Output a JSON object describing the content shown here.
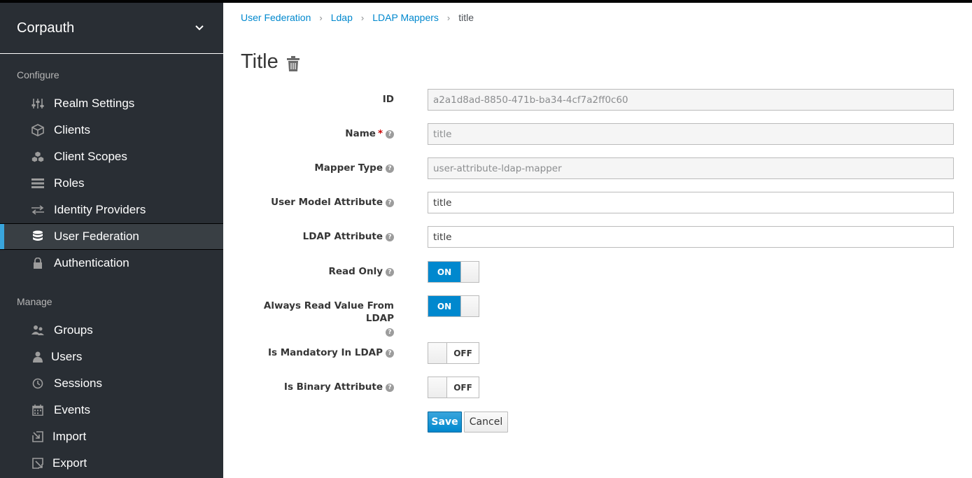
{
  "sidebar": {
    "realm": "Corpauth",
    "configure_label": "Configure",
    "configure_items": [
      {
        "label": "Realm Settings",
        "icon": "sliders-icon"
      },
      {
        "label": "Clients",
        "icon": "cube-icon"
      },
      {
        "label": "Client Scopes",
        "icon": "cubes-icon"
      },
      {
        "label": "Roles",
        "icon": "list-icon"
      },
      {
        "label": "Identity Providers",
        "icon": "exchange-icon"
      },
      {
        "label": "User Federation",
        "icon": "database-icon",
        "active": true
      },
      {
        "label": "Authentication",
        "icon": "lock-icon"
      }
    ],
    "manage_label": "Manage",
    "manage_items": [
      {
        "label": "Groups",
        "icon": "users-icon"
      },
      {
        "label": "Users",
        "icon": "user-icon"
      },
      {
        "label": "Sessions",
        "icon": "clock-icon"
      },
      {
        "label": "Events",
        "icon": "calendar-icon"
      },
      {
        "label": "Import",
        "icon": "import-icon"
      },
      {
        "label": "Export",
        "icon": "export-icon"
      }
    ]
  },
  "breadcrumb": {
    "items": [
      "User Federation",
      "Ldap",
      "LDAP Mappers"
    ],
    "current": "title"
  },
  "page": {
    "title": "Title"
  },
  "form": {
    "id_label": "ID",
    "id_value": "a2a1d8ad-8850-471b-ba34-4cf7a2ff0c60",
    "name_label": "Name",
    "name_value": "title",
    "mapper_type_label": "Mapper Type",
    "mapper_type_value": "user-attribute-ldap-mapper",
    "user_model_attr_label": "User Model Attribute",
    "user_model_attr_value": "title",
    "ldap_attr_label": "LDAP Attribute",
    "ldap_attr_value": "title",
    "read_only_label": "Read Only",
    "read_only_value": "ON",
    "always_read_label": "Always Read Value From LDAP",
    "always_read_value": "ON",
    "mandatory_label": "Is Mandatory In LDAP",
    "mandatory_value": "OFF",
    "binary_label": "Is Binary Attribute",
    "binary_value": "OFF",
    "save_label": "Save",
    "cancel_label": "Cancel"
  },
  "colors": {
    "sidebar_bg": "#292e34",
    "accent": "#0088ce",
    "active_marker": "#39a5dc"
  }
}
